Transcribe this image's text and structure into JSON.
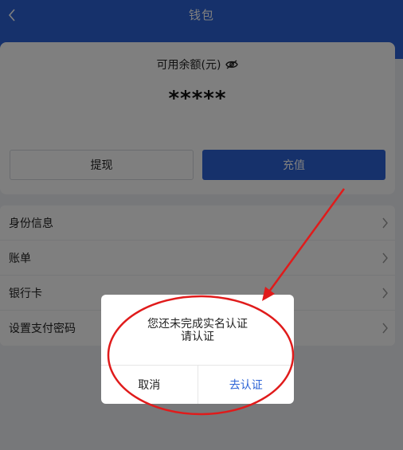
{
  "header": {
    "title": "钱包"
  },
  "balance": {
    "label": "可用余额(元)",
    "value": "*****"
  },
  "actions": {
    "withdraw": "提现",
    "recharge": "充值"
  },
  "menu": {
    "items": [
      {
        "label": "身份信息"
      },
      {
        "label": "账单"
      },
      {
        "label": "银行卡"
      },
      {
        "label": "设置支付密码"
      }
    ]
  },
  "dialog": {
    "message_line1": "您还未完成实名认证",
    "message_line2": "请认证",
    "cancel": "取消",
    "confirm": "去认证"
  },
  "colors": {
    "brand_blue": "#2c63d6",
    "annotation_red": "#e01b1b"
  },
  "icons": {
    "back": "chevron-left-icon",
    "visibility": "eye-off-icon",
    "row_arrow": "chevron-right-icon"
  }
}
